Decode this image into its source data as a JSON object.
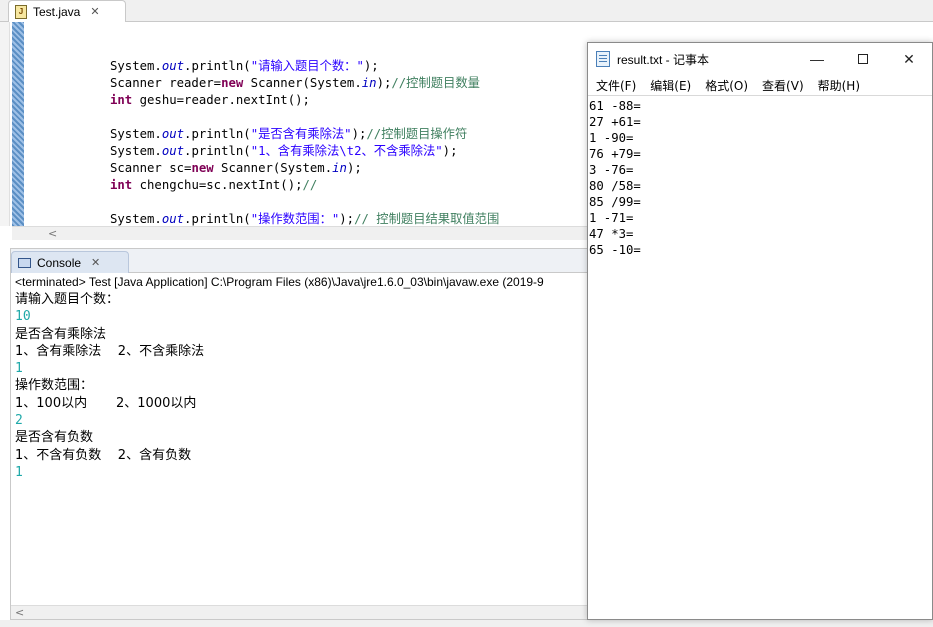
{
  "editor": {
    "tab_label": "Test.java",
    "tab_close": "✕",
    "code_lines": [
      [
        [
          "plain",
          "System."
        ],
        [
          "it",
          "out"
        ],
        [
          "plain",
          ".println("
        ],
        [
          "str",
          "\"请输入题目个数：\""
        ],
        [
          "plain",
          ");"
        ]
      ],
      [
        [
          "plain",
          "Scanner reader="
        ],
        [
          "kw",
          "new"
        ],
        [
          "plain",
          " Scanner(System."
        ],
        [
          "it",
          "in"
        ],
        [
          "plain",
          ");"
        ],
        [
          "cm",
          "//控制题目数量"
        ]
      ],
      [
        [
          "kw",
          "int"
        ],
        [
          "plain",
          " geshu=reader.nextInt();"
        ]
      ],
      [
        [
          "plain",
          ""
        ]
      ],
      [
        [
          "plain",
          "System."
        ],
        [
          "it",
          "out"
        ],
        [
          "plain",
          ".println("
        ],
        [
          "str",
          "\"是否含有乘除法\""
        ],
        [
          "plain",
          ");"
        ],
        [
          "cm",
          "//控制题目操作符"
        ]
      ],
      [
        [
          "plain",
          "System."
        ],
        [
          "it",
          "out"
        ],
        [
          "plain",
          ".println("
        ],
        [
          "str",
          "\"1、含有乘除法\\t2、不含乘除法\""
        ],
        [
          "plain",
          ");"
        ]
      ],
      [
        [
          "plain",
          "Scanner sc="
        ],
        [
          "kw",
          "new"
        ],
        [
          "plain",
          " Scanner(System."
        ],
        [
          "it",
          "in"
        ],
        [
          "plain",
          ");"
        ]
      ],
      [
        [
          "kw",
          "int"
        ],
        [
          "plain",
          " chengchu=sc.nextInt();"
        ],
        [
          "cm",
          "//"
        ]
      ],
      [
        [
          "plain",
          ""
        ]
      ],
      [
        [
          "plain",
          "System."
        ],
        [
          "it",
          "out"
        ],
        [
          "plain",
          ".println("
        ],
        [
          "str",
          "\"操作数范围：\""
        ],
        [
          "plain",
          ");"
        ],
        [
          "cm",
          "// 控制题目结果取值范围"
        ]
      ]
    ],
    "scroll_left": "<"
  },
  "console": {
    "tab_label": "Console",
    "tab_close": "✕",
    "status": "<terminated> Test [Java Application] C:\\Program Files (x86)\\Java\\jre1.6.0_03\\bin\\javaw.exe (2019-9",
    "lines": [
      {
        "text": "请输入题目个数：",
        "kind": "prompt"
      },
      {
        "text": "10",
        "kind": "input"
      },
      {
        "text": "是否含有乘除法",
        "kind": "prompt"
      },
      {
        "text": "1、含有乘除法    2、不含乘除法",
        "kind": "prompt"
      },
      {
        "text": "1",
        "kind": "input"
      },
      {
        "text": "操作数范围：",
        "kind": "prompt"
      },
      {
        "text": "1、100以内       2、1000以内",
        "kind": "prompt"
      },
      {
        "text": "2",
        "kind": "input"
      },
      {
        "text": "是否含有负数",
        "kind": "prompt"
      },
      {
        "text": "1、不含有负数    2、含有负数",
        "kind": "prompt"
      },
      {
        "text": "1",
        "kind": "input"
      }
    ],
    "scroll_left": "<"
  },
  "notepad": {
    "title": "result.txt - 记事本",
    "minimize": "—",
    "close": "✕",
    "menu": [
      "文件(F)",
      "编辑(E)",
      "格式(O)",
      "查看(V)",
      "帮助(H)"
    ],
    "content": "61 -88=\n27 +61=\n1 -90=\n76 +79=\n3 -76=\n80 /58=\n85 /99=\n1 -71=\n47 *3=\n65 -10="
  }
}
